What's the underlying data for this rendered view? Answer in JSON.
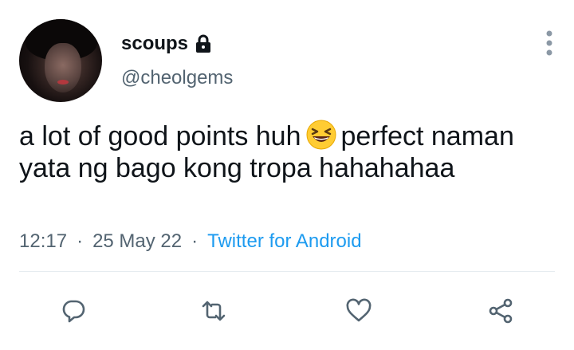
{
  "author": {
    "display_name": "scoups",
    "handle": "@cheolgems"
  },
  "tweet": {
    "text_part1": "a lot of good points huh",
    "emoji_name": "grinning-squinting-face-emoji",
    "text_part2": "perfect naman yata ng bago kong tropa hahahahaa"
  },
  "meta": {
    "time": "12:17",
    "separator": "·",
    "date": "25 May 22",
    "source": "Twitter for Android"
  },
  "actions": {
    "reply_icon": "reply-icon",
    "retweet_icon": "retweet-icon",
    "like_icon": "heart-icon",
    "share_icon": "share-icon"
  },
  "colors": {
    "text": "#0f1419",
    "secondary": "#536471",
    "accent": "#1d9bf0",
    "divider": "#e6ecf0"
  }
}
